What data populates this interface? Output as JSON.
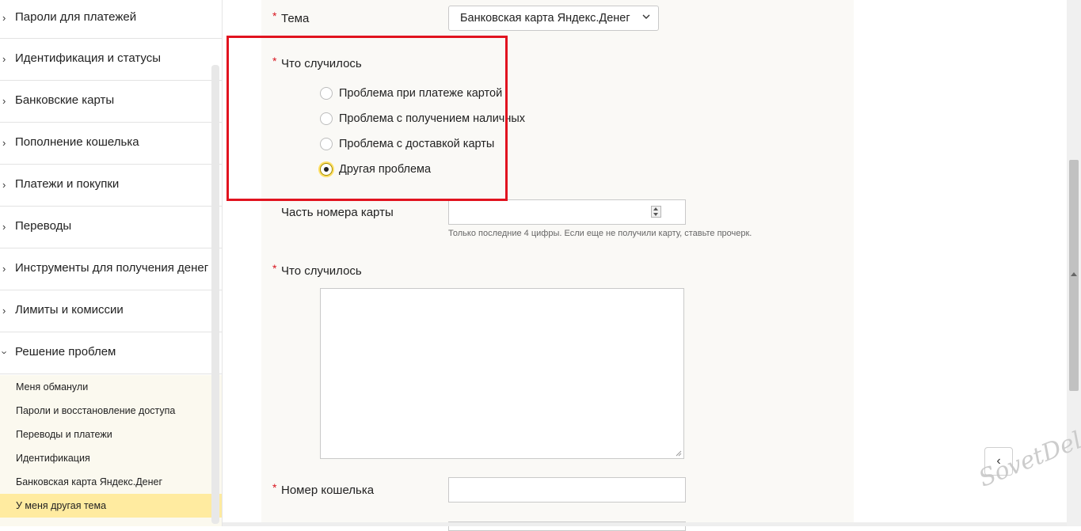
{
  "sidebar": {
    "items": [
      {
        "label": "Пароли для платежей"
      },
      {
        "label": "Идентификация и статусы"
      },
      {
        "label": "Банковские карты"
      },
      {
        "label": "Пополнение кошелька"
      },
      {
        "label": "Платежи и покупки"
      },
      {
        "label": "Переводы"
      },
      {
        "label": "Инструменты для получения денег"
      },
      {
        "label": "Лимиты и комиссии"
      },
      {
        "label": "Решение проблем"
      }
    ],
    "subitems": [
      {
        "label": "Меня обманули"
      },
      {
        "label": "Пароли и восстановление доступа"
      },
      {
        "label": "Переводы и платежи"
      },
      {
        "label": "Идентификация"
      },
      {
        "label": "Банковская карта Яндекс.Денег"
      },
      {
        "label": "У меня другая тема"
      }
    ]
  },
  "form": {
    "required_mark": "*",
    "topic_label": "Тема",
    "topic_value": "Банковская карта Яндекс.Денег",
    "what_happened_label": "Что случилось",
    "options": [
      {
        "label": "Проблема при платеже картой",
        "checked": false
      },
      {
        "label": "Проблема с получением наличных",
        "checked": false
      },
      {
        "label": "Проблема с доставкой карты",
        "checked": false
      },
      {
        "label": "Другая проблема",
        "checked": true
      }
    ],
    "card_part_label": "Часть номера карты",
    "card_part_hint": "Только последние 4 цифры. Если еще не получили карту, ставьте прочерк.",
    "description_label": "Что случилось",
    "wallet_label": "Номер кошелька"
  },
  "nav": {
    "prev_symbol": "‹"
  },
  "watermark": "SovetDela",
  "colors": {
    "highlight": "#e1131f",
    "active_sub": "#ffeba0",
    "required": "#d8141e"
  }
}
